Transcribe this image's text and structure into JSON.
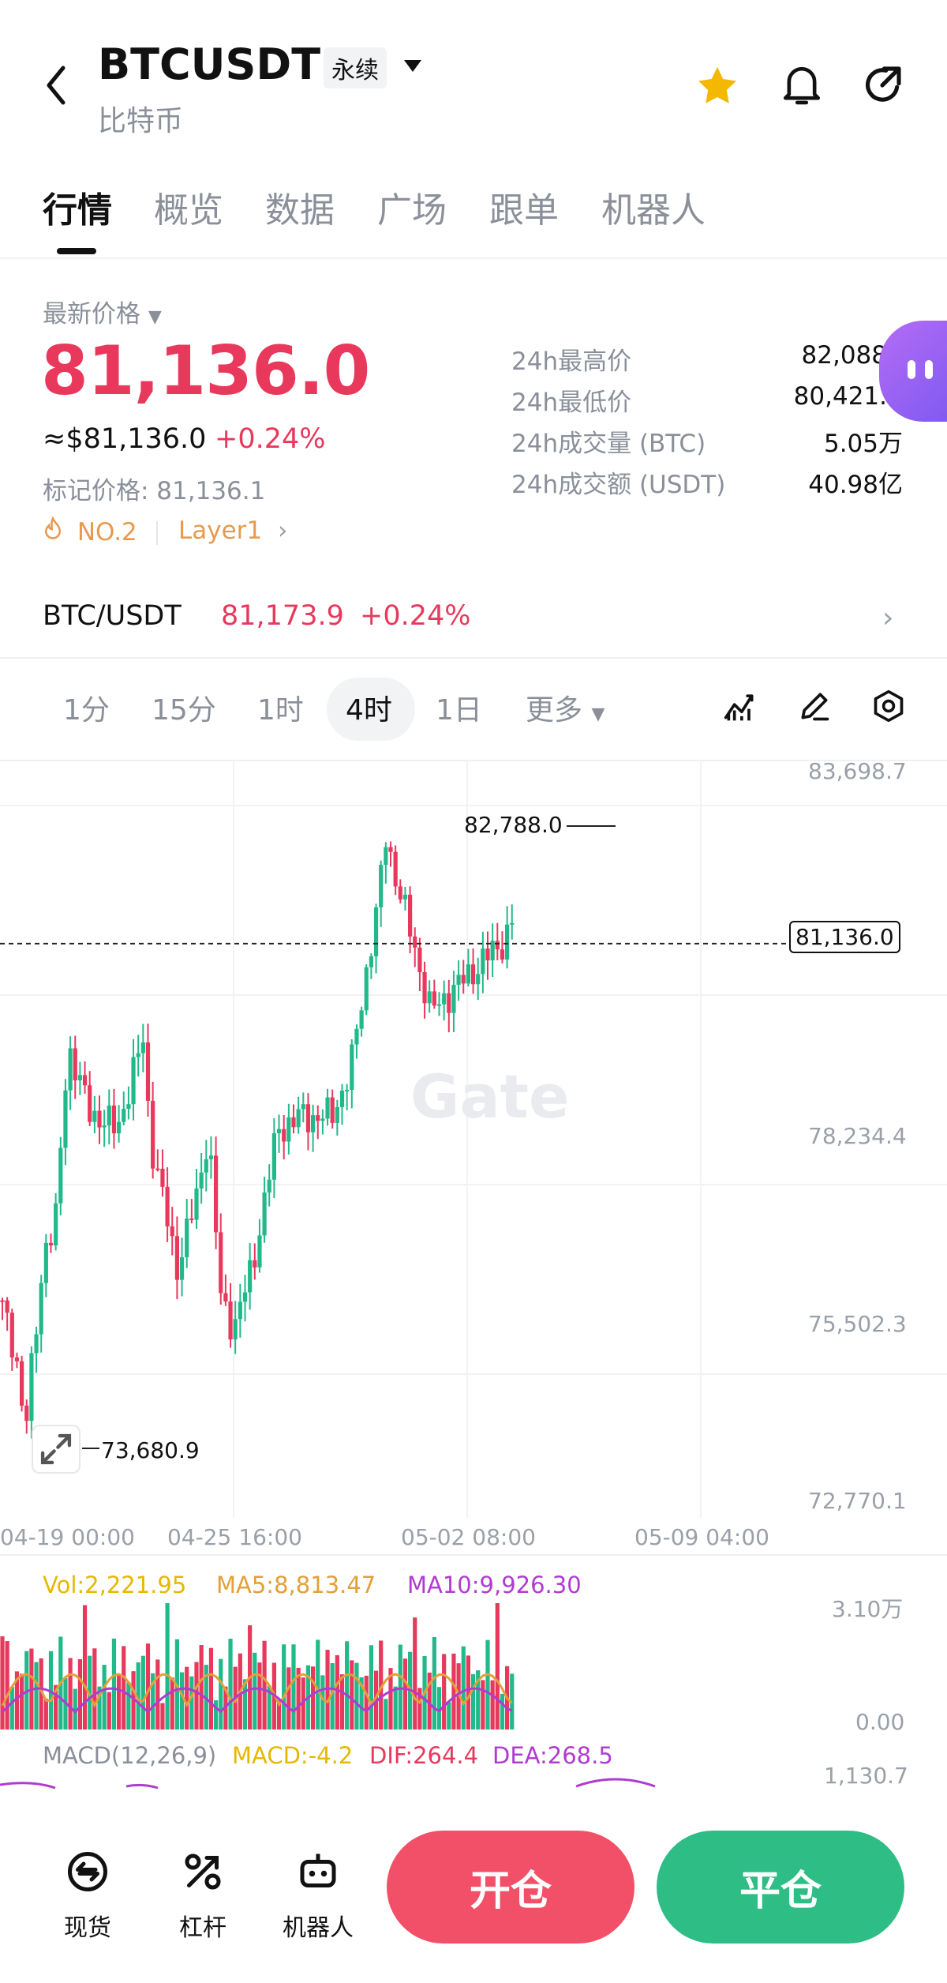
{
  "header": {
    "symbol": "BTCUSDT",
    "contract_type": "永续",
    "subtitle": "比特币"
  },
  "tabs": [
    "行情",
    "概览",
    "数据",
    "广场",
    "跟单",
    "机器人"
  ],
  "price": {
    "label": "最新价格",
    "last": "81,136.0",
    "usd": "≈$81,136.0",
    "change": "+0.24%",
    "mark": "标记价格: 81,136.1",
    "rank": "NO.2",
    "tag": "Layer1"
  },
  "stats": [
    {
      "label": "24h最高价",
      "value": "82,088"
    },
    {
      "label": "24h最低价",
      "value": "80,421."
    },
    {
      "label": "24h成交量 (BTC)",
      "value": "5.05万"
    },
    {
      "label": "24h成交额 (USDT)",
      "value": "40.98亿"
    }
  ],
  "spot": {
    "pair": "BTC/USDT",
    "price": "81,173.9",
    "change": "+0.24%"
  },
  "timeframes": [
    "1分",
    "15分",
    "1时",
    "4时",
    "1日",
    "更多"
  ],
  "chart": {
    "watermark": "Gate",
    "y_labels": [
      "83,698.7",
      "78,234.4",
      "75,502.3",
      "72,770.1"
    ],
    "x_labels": [
      "04-19 00:00",
      "04-25 16:00",
      "05-02 08:00",
      "05-09 04:00"
    ],
    "high_label": "82,788.0",
    "low_label": "73,680.9",
    "current_label": "81,136.0"
  },
  "volume": {
    "vol": "Vol:2,221.95",
    "ma5": "MA5:8,813.47",
    "ma10": "MA10:9,926.30",
    "top": "3.10万",
    "bottom": "0.00"
  },
  "macd": {
    "title": "MACD(12,26,9)",
    "macd": "MACD:-4.2",
    "dif": "DIF:264.4",
    "dea": "DEA:268.5",
    "top": "1,130.7"
  },
  "chart_data": {
    "type": "candlestick",
    "x": [
      "04-19 00:00",
      "04-25 16:00",
      "05-02 08:00",
      "05-09 04:00"
    ],
    "high": 82788.0,
    "low": 73680.9,
    "current": 81136.0,
    "ylim": [
      72770.1,
      83698.7
    ]
  },
  "bottom": {
    "spot": "现货",
    "leverage": "杠杆",
    "bot": "机器人",
    "open": "开仓",
    "close": "平仓"
  },
  "colors": {
    "up": "#22b98a",
    "down": "#e8395d",
    "ma5": "#e2a03a",
    "ma10": "#b03bd1",
    "vol": "#e6b800",
    "star": "#f5b800"
  }
}
